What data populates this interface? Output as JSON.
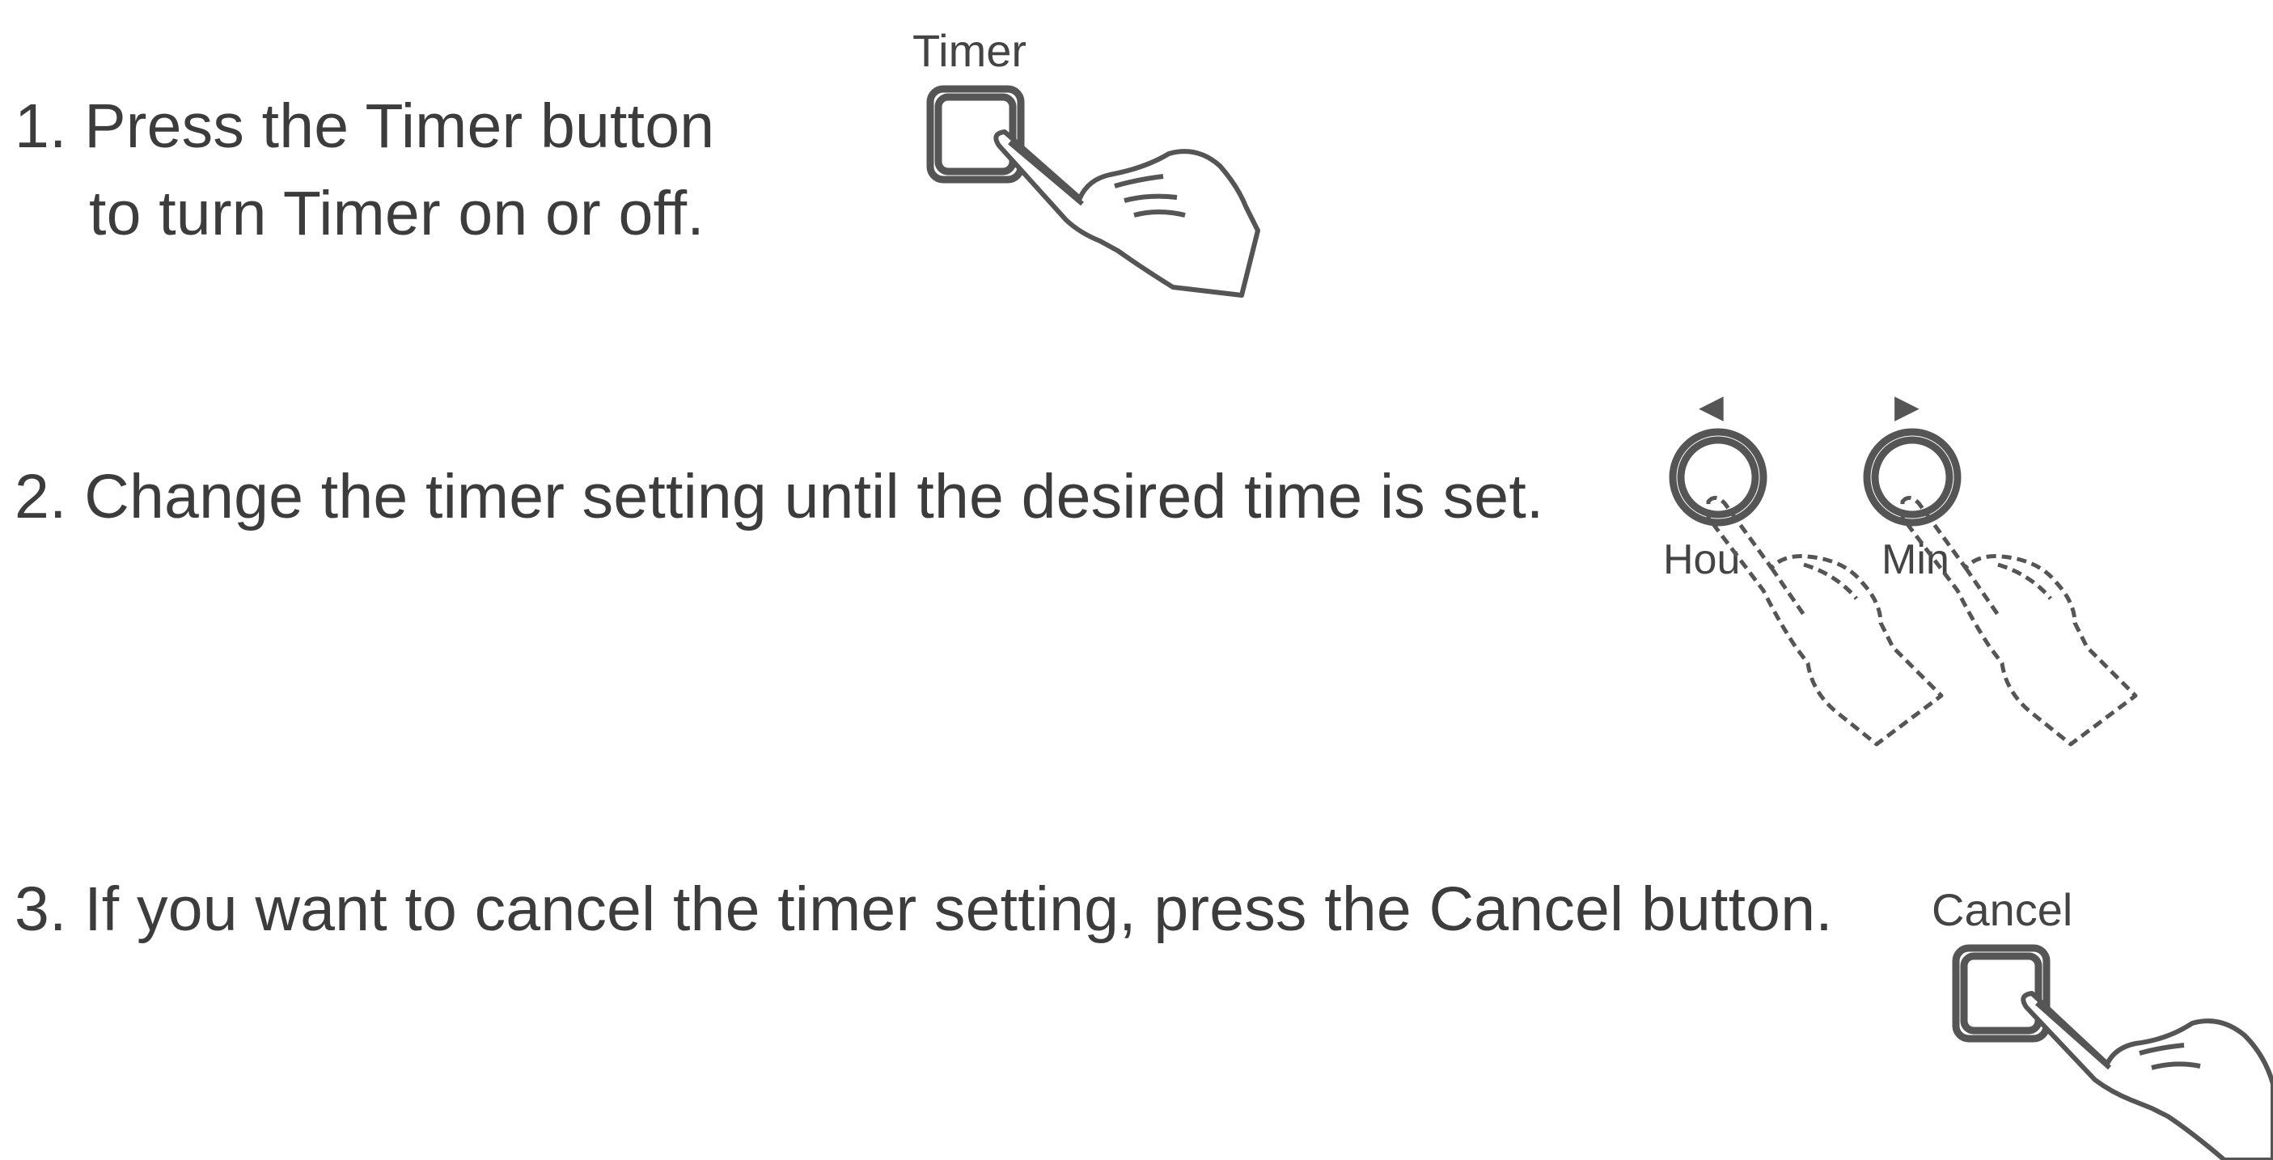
{
  "steps": [
    {
      "number": "1.",
      "lines": [
        "Press the Timer button",
        "to turn Timer on or off."
      ],
      "button_label": "Timer",
      "icon": "hand-pressing-square-button"
    },
    {
      "number": "2.",
      "lines": [
        "Change the timer setting until the desired time is set."
      ],
      "left_arrow": "◀",
      "right_arrow": "▶",
      "left_label": "Hou",
      "right_label": "Min",
      "icon": "two-hands-pressing-round-buttons"
    },
    {
      "number": "3.",
      "lines": [
        "If you want to cancel the timer setting, press the Cancel button."
      ],
      "button_label": "Cancel",
      "icon": "hand-pressing-square-button"
    }
  ],
  "colors": {
    "text": "#3c3c3c",
    "stroke": "#555555"
  }
}
